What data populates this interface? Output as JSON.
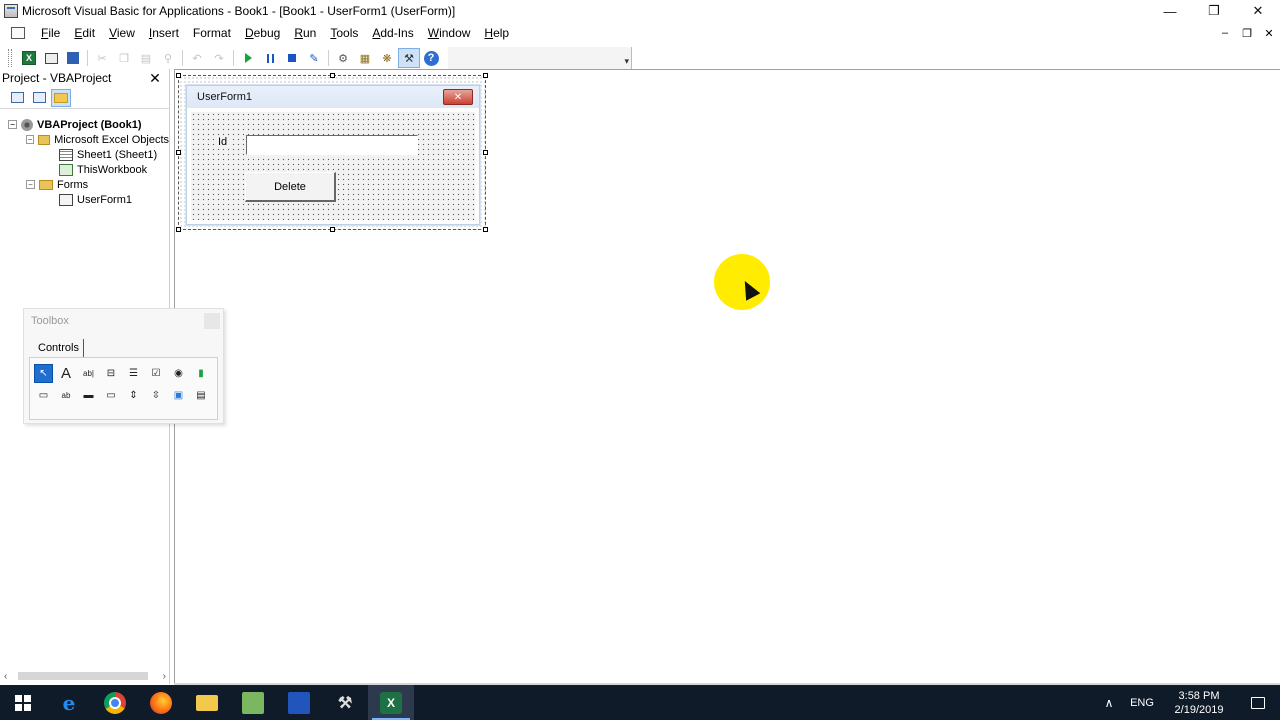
{
  "window": {
    "title": "Microsoft Visual Basic for Applications - Book1 - [Book1 - UserForm1 (UserForm)]",
    "minimize": "—",
    "restore": "❐",
    "close": "✕"
  },
  "menu": {
    "items": [
      {
        "acc": "F",
        "rest": "ile"
      },
      {
        "acc": "E",
        "rest": "dit"
      },
      {
        "acc": "V",
        "rest": "iew"
      },
      {
        "acc": "I",
        "rest": "nsert"
      },
      {
        "acc": "F",
        "rest": "ormat",
        "pre": ""
      },
      {
        "acc": "D",
        "rest": "ebug"
      },
      {
        "acc": "R",
        "rest": "un"
      },
      {
        "acc": "T",
        "rest": "ools"
      },
      {
        "acc": "A",
        "rest": "dd-Ins"
      },
      {
        "acc": "W",
        "rest": "indow"
      },
      {
        "acc": "H",
        "rest": "elp"
      }
    ],
    "mdi_min": "‒",
    "mdi_restore": "❐",
    "mdi_close": "✕"
  },
  "toolbar": {
    "excel_label": "X",
    "help_label": "?"
  },
  "project": {
    "title": "Project - VBAProject",
    "close": "✕",
    "tree": {
      "root": "VBAProject (Book1)",
      "excel_objects": "Microsoft Excel Objects",
      "sheet1": "Sheet1 (Sheet1)",
      "thisworkbook": "ThisWorkbook",
      "forms": "Forms",
      "userform1": "UserForm1"
    }
  },
  "toolbox": {
    "title": "Toolbox",
    "tab": "Controls",
    "row1": [
      "↖",
      "A",
      "ab|",
      "⊟",
      "☰",
      "☑",
      "◉",
      "▮"
    ],
    "row2": [
      "▭",
      "ab",
      "▬",
      "▭",
      "⇕",
      "⇳",
      "▣",
      "▤"
    ]
  },
  "userform": {
    "title": "UserForm1",
    "close": "✕",
    "label": "Id",
    "textbox_value": "",
    "button": "Delete"
  },
  "taskbar": {
    "excel": "X",
    "lang": "ENG",
    "time": "3:58 PM",
    "date": "2/19/2019",
    "chevron": "∧"
  }
}
